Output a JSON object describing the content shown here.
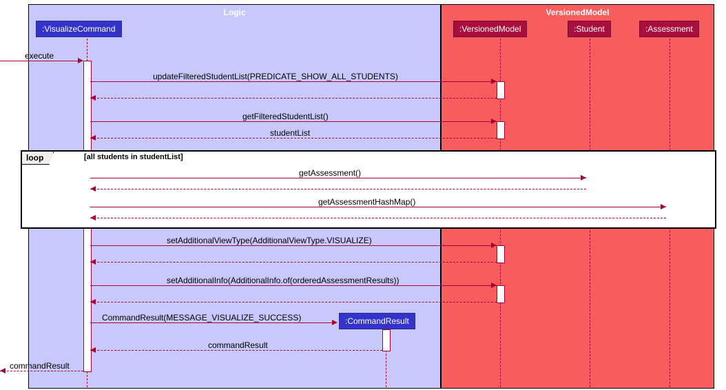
{
  "groups": {
    "logic": "Logic",
    "model": "VersionedModel"
  },
  "participants": {
    "visualize": ":VisualizeCommand",
    "versioned": ":VersionedModel",
    "student": ":Student",
    "assessment": ":Assessment",
    "cmdresult": ":CommandResult"
  },
  "messages": {
    "execute": "execute",
    "updateFiltered": "updateFilteredStudentList(PREDICATE_SHOW_ALL_STUDENTS)",
    "getFiltered": "getFilteredStudentList()",
    "studentList": "studentList",
    "getAssessment": "getAssessment()",
    "getHashMap": "getAssessmentHashMap()",
    "setViewType": "setAdditionalViewType(AdditionalViewType.VISUALIZE)",
    "setInfo": "setAdditionalInfo(AdditionalInfo.of(orderedAssessmentResults))",
    "newCmdRes": "CommandResult(MESSAGE_VISUALIZE_SUCCESS)",
    "retCmdRes": "commandResult",
    "retCmdRes2": "commandResult"
  },
  "loop": {
    "tag": "loop",
    "guard": "[all students in studentList]"
  }
}
